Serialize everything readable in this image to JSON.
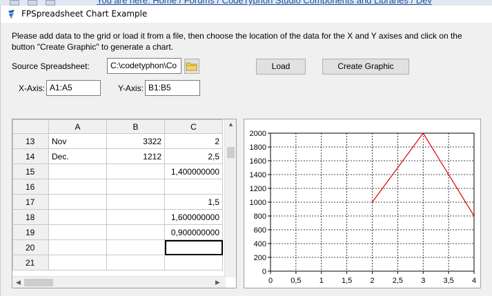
{
  "background": {
    "text": "You are here:  Home /  Forums /  CodeTyphon Studio Components and Libraries /  Dev"
  },
  "window": {
    "title": "FPSpreadsheet Chart Example"
  },
  "instructions": "Please add data to the grid or load it from a file, then choose the location of the data for the X and Y axises and click on the button \"Create Graphic\" to generate a chart.",
  "source": {
    "label": "Source Spreadsheet:",
    "value": "C:\\codetyphon\\Co"
  },
  "load_button": "Load",
  "create_button": "Create Graphic",
  "x_axis": {
    "label": "X-Axis:",
    "value": "A1:A5"
  },
  "y_axis": {
    "label": "Y-Axis:",
    "value": "B1:B5"
  },
  "grid": {
    "columns": [
      "A",
      "B",
      "C"
    ],
    "rows": [
      {
        "num": "13",
        "a": "Nov",
        "b": "3322",
        "c": "2"
      },
      {
        "num": "14",
        "a": "Dec.",
        "b": "1212",
        "c": "2,5"
      },
      {
        "num": "15",
        "a": "",
        "b": "",
        "c": "1,400000000"
      },
      {
        "num": "16",
        "a": "",
        "b": "",
        "c": ""
      },
      {
        "num": "17",
        "a": "",
        "b": "",
        "c": "1,5"
      },
      {
        "num": "18",
        "a": "",
        "b": "",
        "c": "1,600000000"
      },
      {
        "num": "19",
        "a": "",
        "b": "",
        "c": "0,900000000"
      },
      {
        "num": "20",
        "a": "",
        "b": "",
        "c": ""
      },
      {
        "num": "21",
        "a": "",
        "b": "",
        "c": ""
      }
    ]
  },
  "chart_data": {
    "type": "line",
    "x": [
      2,
      3,
      4
    ],
    "y": [
      1000,
      2000,
      800
    ],
    "xlim": [
      0,
      4
    ],
    "ylim": [
      0,
      2000
    ],
    "xticks": [
      "0",
      "0,5",
      "1",
      "1,5",
      "2",
      "2,5",
      "3",
      "3,5",
      "4"
    ],
    "yticks": [
      "0",
      "200",
      "400",
      "600",
      "800",
      "1000",
      "1200",
      "1400",
      "1600",
      "1800",
      "2000"
    ],
    "grid": true,
    "line_color": "#e00000"
  }
}
